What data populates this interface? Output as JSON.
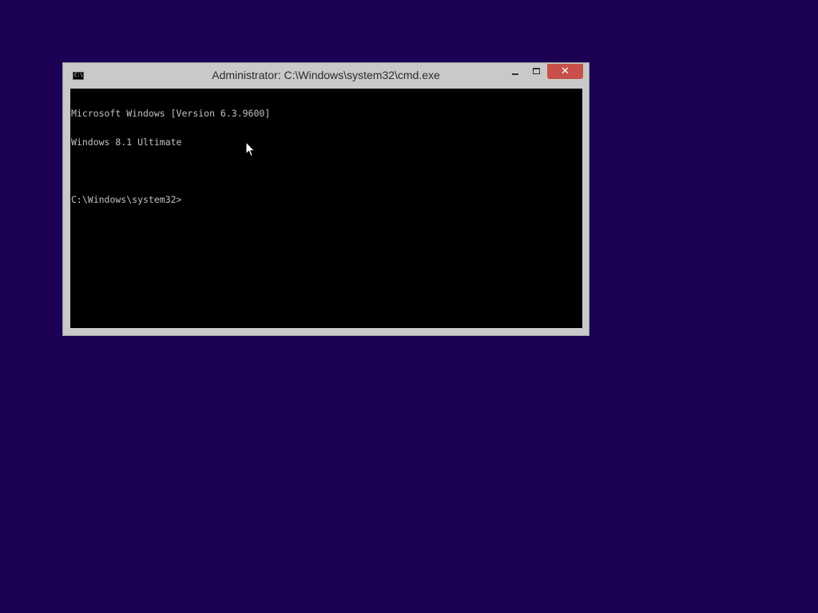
{
  "window": {
    "title": "Administrator: C:\\Windows\\system32\\cmd.exe",
    "app_icon_text": "C:\\",
    "close_glyph": "✕"
  },
  "console": {
    "lines": [
      "Microsoft Windows [Version 6.3.9600]",
      "Windows 8.1 Ultimate",
      "",
      "C:\\Windows\\system32>"
    ]
  },
  "colors": {
    "desktop_background": "#1b0054",
    "console_background": "#000000",
    "console_text": "#c0c0c0",
    "close_button": "#c7504a"
  },
  "icons": {
    "app": "cmd-console-icon",
    "minimize": "minimize-icon",
    "maximize": "maximize-icon",
    "close": "close-icon",
    "pointer": "mouse-pointer-icon"
  }
}
